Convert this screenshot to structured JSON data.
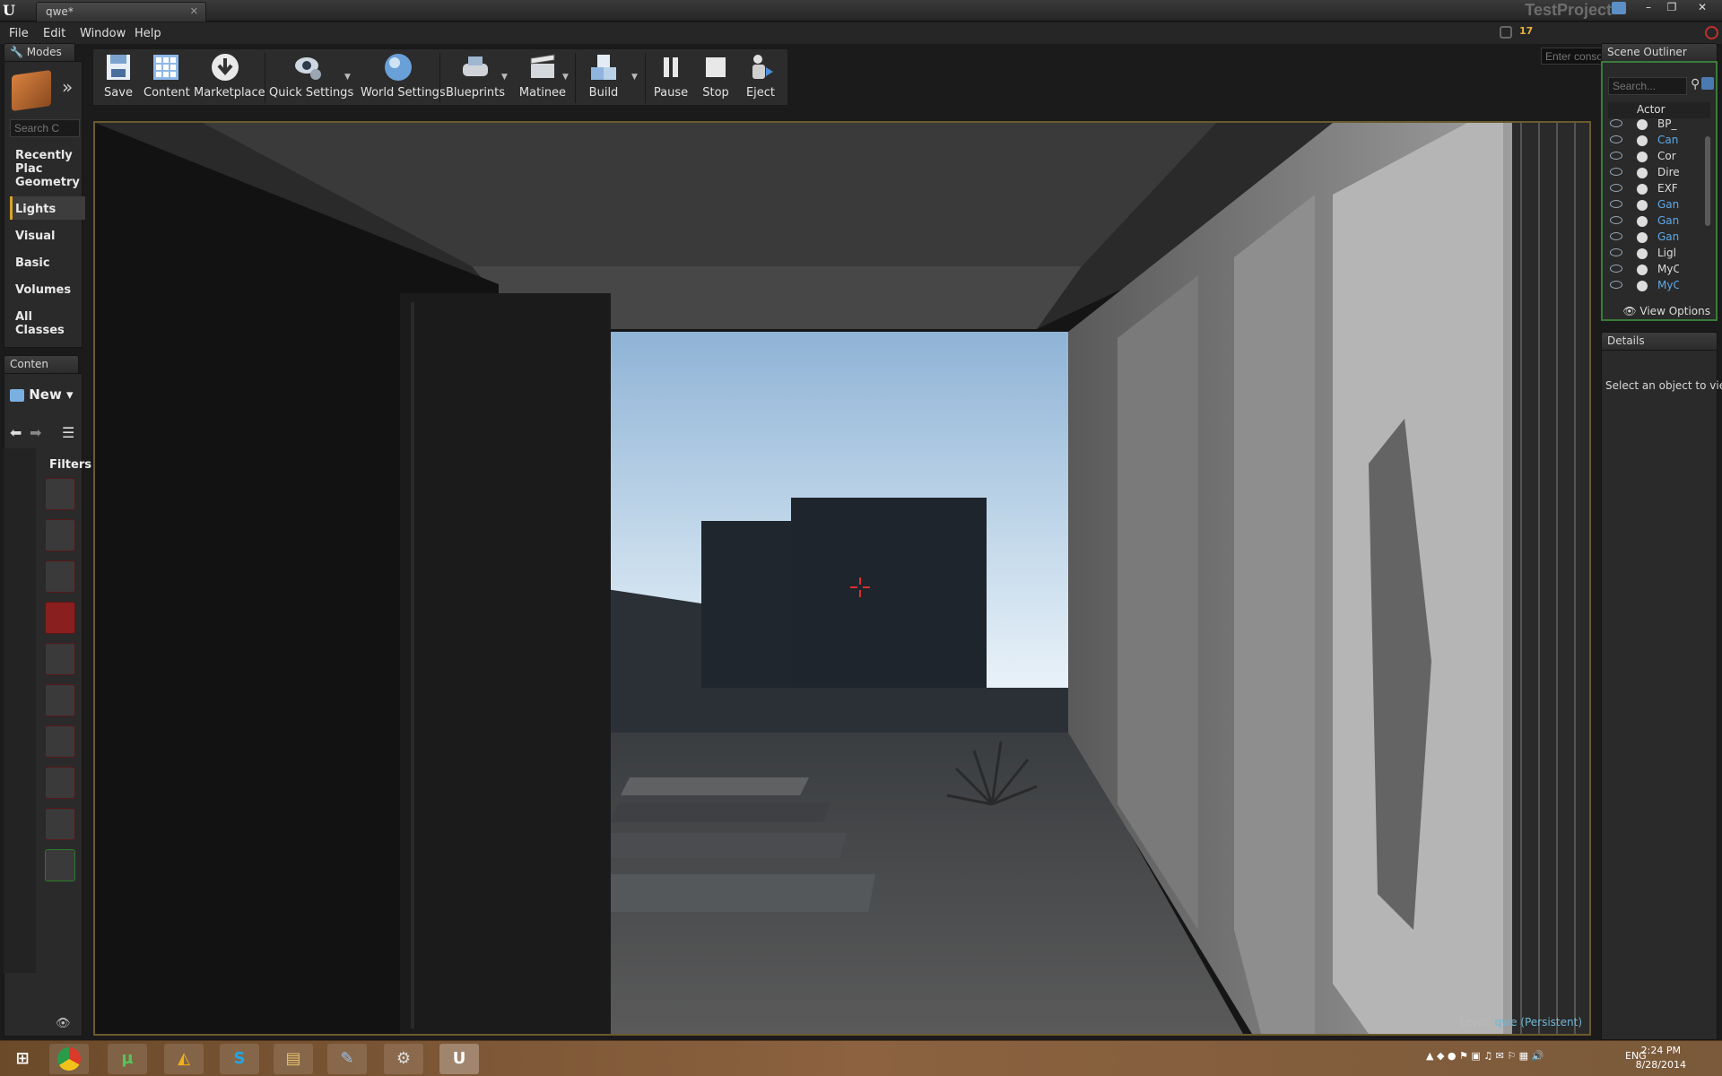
{
  "window": {
    "doc_tab": "qwe*",
    "project": "TestProject",
    "controls": [
      "–",
      "❐",
      "✕"
    ]
  },
  "menu": [
    "File",
    "Edit",
    "Window",
    "Help"
  ],
  "console": {
    "placeholder": "Enter console command",
    "badge": "17"
  },
  "modes": {
    "tab": "Modes",
    "search_placeholder": "Search C",
    "categories": [
      "Recently Plac",
      "Geometry",
      "Lights",
      "Visual",
      "Basic",
      "Volumes",
      "All Classes"
    ],
    "selected": "Lights"
  },
  "content_browser": {
    "tab": "Conten",
    "new_label": "New",
    "filters_label": "Filters"
  },
  "toolbar": {
    "save": "Save",
    "content": "Content",
    "marketplace": "Marketplace",
    "quick_settings": "Quick Settings",
    "world_settings": "World Settings",
    "blueprints": "Blueprints",
    "matinee": "Matinee",
    "build": "Build",
    "pause": "Pause",
    "stop": "Stop",
    "eject": "Eject"
  },
  "viewport": {
    "level_prefix": "Level:",
    "level_name": "qwe (Persistent)"
  },
  "outliner": {
    "tab": "Scene Outliner",
    "search_placeholder": "Search...",
    "column": "Actor",
    "rows": [
      {
        "label": "BP_",
        "blue": false
      },
      {
        "label": "Can",
        "blue": true
      },
      {
        "label": "Cor",
        "blue": false
      },
      {
        "label": "Dire",
        "blue": false
      },
      {
        "label": "EXF",
        "blue": false
      },
      {
        "label": "Gan",
        "blue": true
      },
      {
        "label": "Gan",
        "blue": true
      },
      {
        "label": "Gan",
        "blue": true
      },
      {
        "label": "Ligl",
        "blue": false
      },
      {
        "label": "MyC",
        "blue": false
      },
      {
        "label": "MyC",
        "blue": true
      }
    ],
    "view_options": "View Options"
  },
  "details": {
    "tab": "Details",
    "empty_text": "Select an object to view"
  },
  "taskbar": {
    "tray_lang": "ENG",
    "time": "2:24 PM",
    "date": "8/28/2014"
  }
}
